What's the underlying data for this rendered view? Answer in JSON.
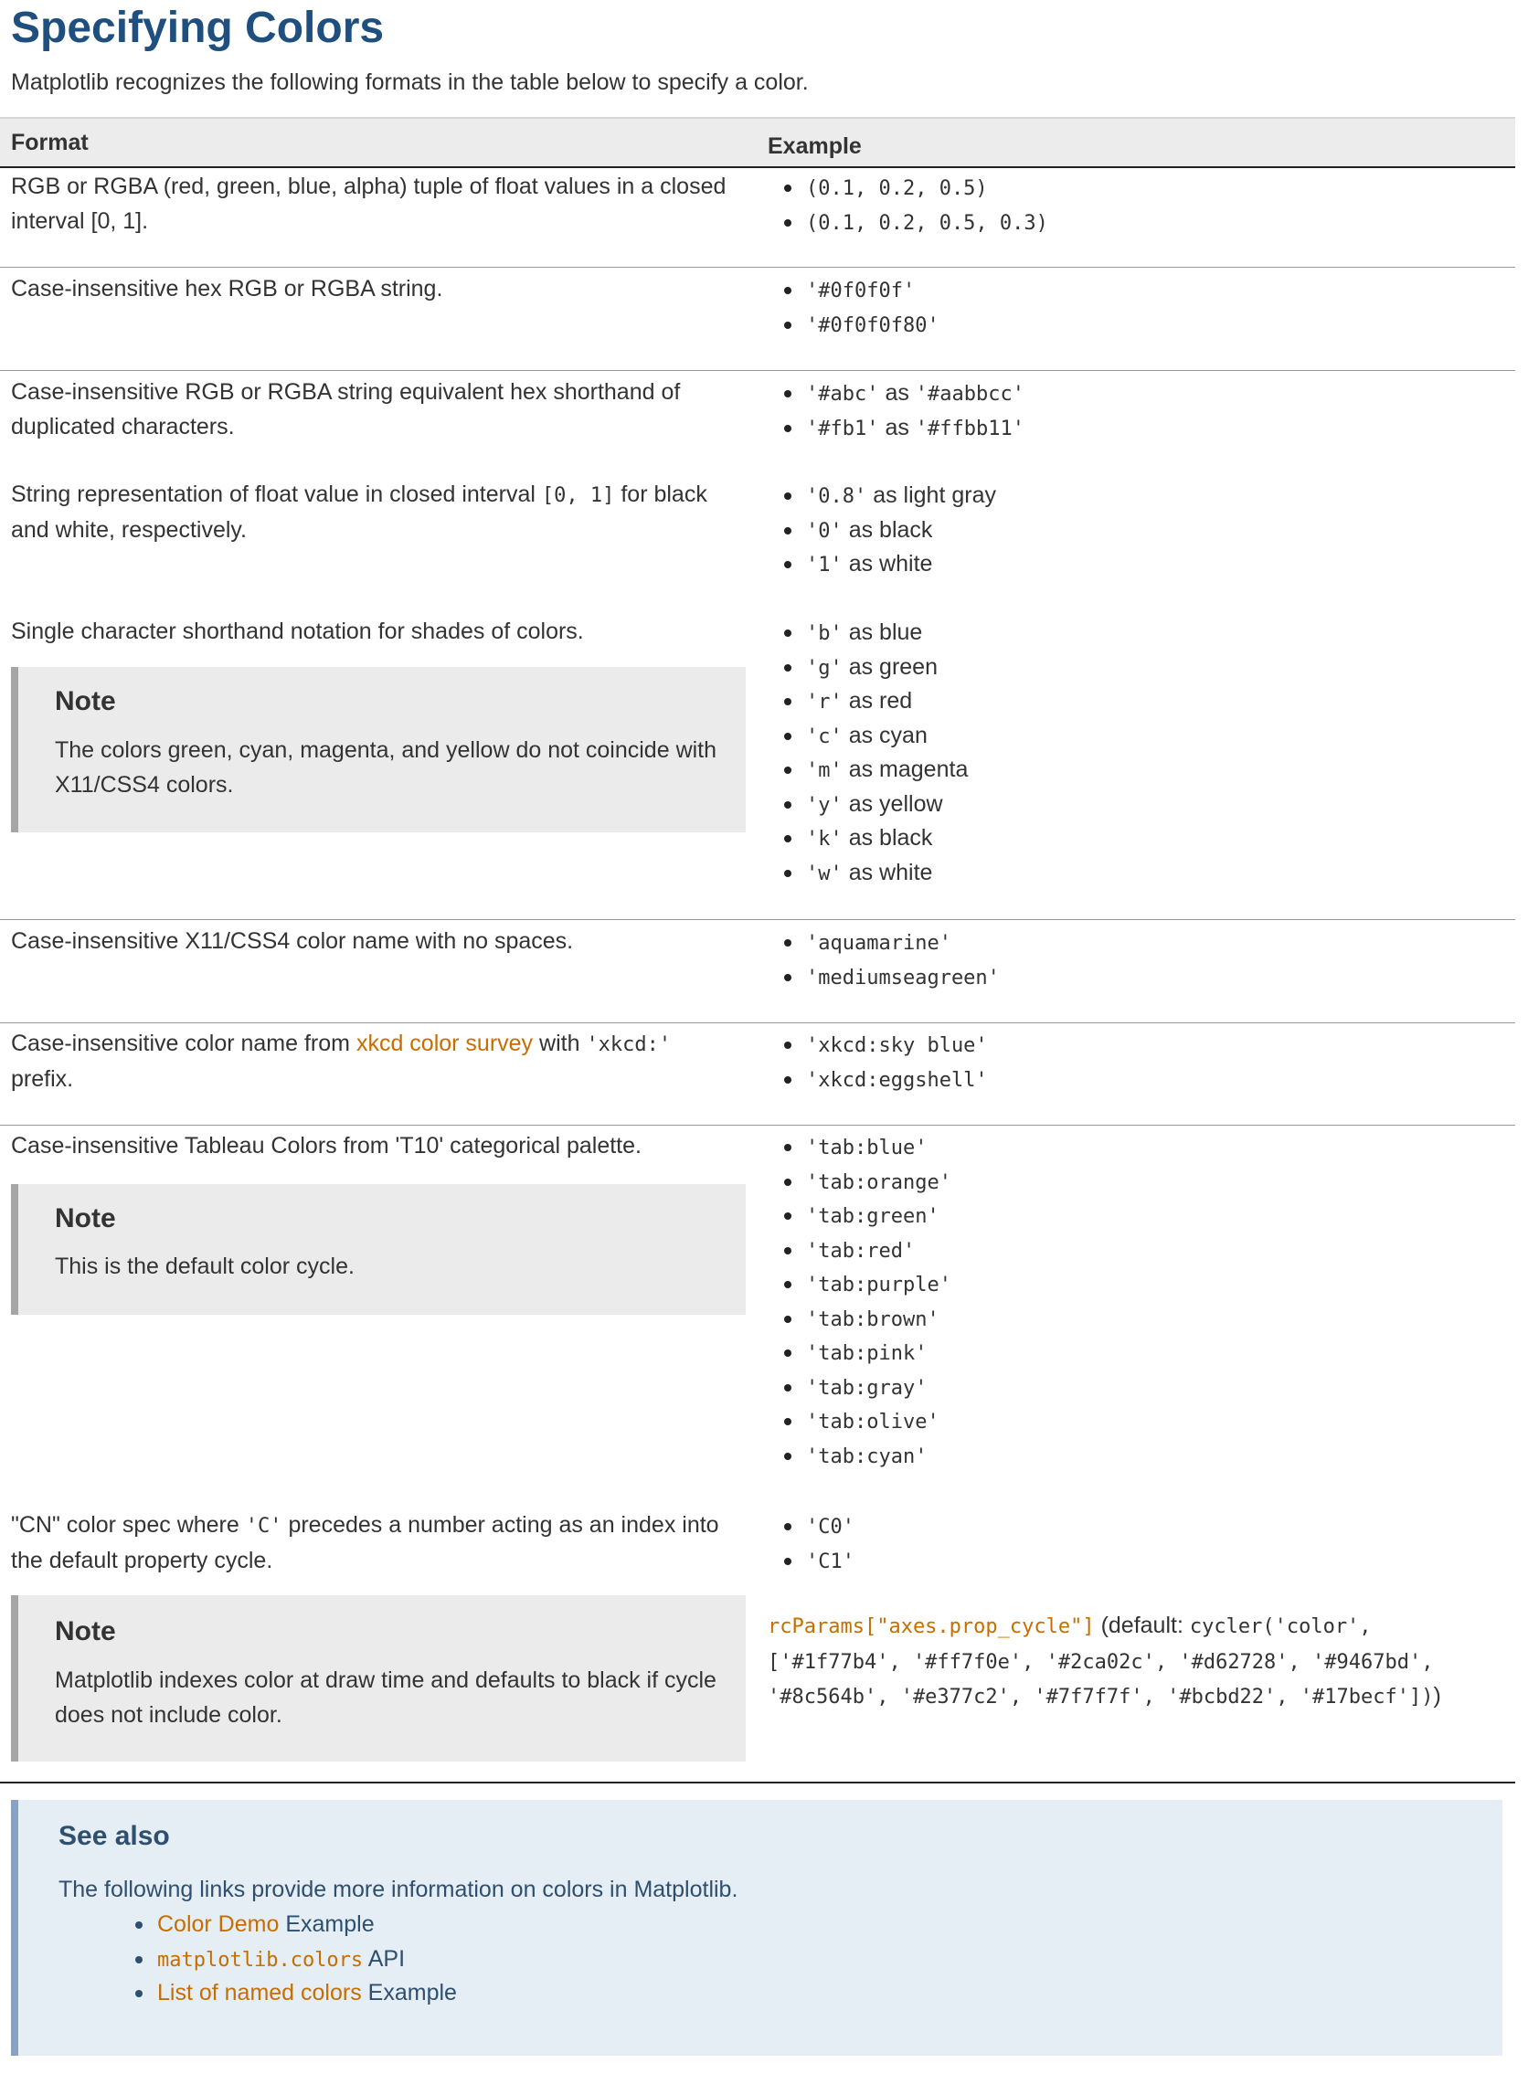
{
  "page": {
    "title": "Specifying Colors",
    "intro": "Matplotlib recognizes the following formats in the table below to specify a color."
  },
  "table": {
    "headers": {
      "format": "Format",
      "example": "Example"
    },
    "rows": [
      {
        "format": "RGB or RGBA (red, green, blue, alpha) tuple of float values in a closed interval [0, 1].",
        "examples": [
          {
            "code": "(0.1, 0.2, 0.5)"
          },
          {
            "code": "(0.1, 0.2, 0.5, 0.3)"
          }
        ]
      },
      {
        "format": "Case-insensitive hex RGB or RGBA string.",
        "examples": [
          {
            "code": "'#0f0f0f'"
          },
          {
            "code": "'#0f0f0f80'"
          }
        ]
      },
      {
        "format": "Case-insensitive RGB or RGBA string equivalent hex shorthand of duplicated characters.",
        "examples": [
          {
            "code": "'#abc'",
            "text": "as",
            "code2": "'#aabbcc'"
          },
          {
            "code": "'#fb1'",
            "text": "as",
            "code2": "'#ffbb11'"
          }
        ]
      },
      {
        "format_pre": "String representation of float value in closed interval",
        "format_code": "[0, 1]",
        "format_post": "for black and white, respectively.",
        "examples": [
          {
            "code": "'0.8'",
            "text": "as light gray"
          },
          {
            "code": "'0'",
            "text": "as black"
          },
          {
            "code": "'1'",
            "text": "as white"
          }
        ]
      },
      {
        "format": "Single character shorthand notation for shades of colors.",
        "note": {
          "title": "Note",
          "body": "The colors green, cyan, magenta, and yellow do not coincide with X11/CSS4 colors."
        },
        "examples": [
          {
            "code": "'b'",
            "text": "as blue"
          },
          {
            "code": "'g'",
            "text": "as green"
          },
          {
            "code": "'r'",
            "text": "as red"
          },
          {
            "code": "'c'",
            "text": "as cyan"
          },
          {
            "code": "'m'",
            "text": "as magenta"
          },
          {
            "code": "'y'",
            "text": "as yellow"
          },
          {
            "code": "'k'",
            "text": "as black"
          },
          {
            "code": "'w'",
            "text": "as white"
          }
        ]
      },
      {
        "format": "Case-insensitive X11/CSS4 color name with no spaces.",
        "examples": [
          {
            "code": "'aquamarine'"
          },
          {
            "code": "'mediumseagreen'"
          }
        ]
      },
      {
        "format_pre": "Case-insensitive color name from",
        "format_link": "xkcd color survey",
        "format_mid": "with",
        "format_code": "'xkcd:'",
        "format_post": "prefix.",
        "examples": [
          {
            "code": "'xkcd:sky blue'"
          },
          {
            "code": "'xkcd:eggshell'"
          }
        ]
      },
      {
        "format": "Case-insensitive Tableau Colors from 'T10' categorical palette.",
        "note": {
          "title": "Note",
          "body": "This is the default color cycle."
        },
        "examples": [
          {
            "code": "'tab:blue'"
          },
          {
            "code": "'tab:orange'"
          },
          {
            "code": "'tab:green'"
          },
          {
            "code": "'tab:red'"
          },
          {
            "code": "'tab:purple'"
          },
          {
            "code": "'tab:brown'"
          },
          {
            "code": "'tab:pink'"
          },
          {
            "code": "'tab:gray'"
          },
          {
            "code": "'tab:olive'"
          },
          {
            "code": "'tab:cyan'"
          }
        ]
      },
      {
        "format_pre": "\"CN\" color spec where",
        "format_code": "'C'",
        "format_post": "precedes a number acting as an index into the default property cycle.",
        "note": {
          "title": "Note",
          "body": "Matplotlib indexes color at draw time and defaults to black if cycle does not include color."
        },
        "examples": [
          {
            "code": "'C0'"
          },
          {
            "code": "'C1'"
          }
        ],
        "rcparam": {
          "name": "rcParams[\"axes.prop_cycle\"]",
          "default_open": "(default:",
          "default_code_1": "cycler('color',",
          "default_code_2": "['#1f77b4', '#ff7f0e', '#2ca02c', '#d62728', '#9467bd',",
          "default_code_3": "'#8c564b', '#e377c2', '#7f7f7f', '#bcbd22', '#17becf'])",
          "default_close": ")"
        }
      }
    ]
  },
  "see_also": {
    "title": "See also",
    "text": "The following links provide more information on colors in Matplotlib.",
    "items": [
      {
        "link": "Color Demo",
        "suffix": "Example",
        "link_is_code": false
      },
      {
        "link": "matplotlib.colors",
        "suffix": "API",
        "link_is_code": true
      },
      {
        "link": "List of named colors",
        "suffix": "Example",
        "link_is_code": false
      }
    ]
  },
  "colors": {
    "title": "#1f4f7f",
    "link": "#c76e00",
    "note_bg": "#ebebeb",
    "seealso_bg": "#e5edf5"
  }
}
